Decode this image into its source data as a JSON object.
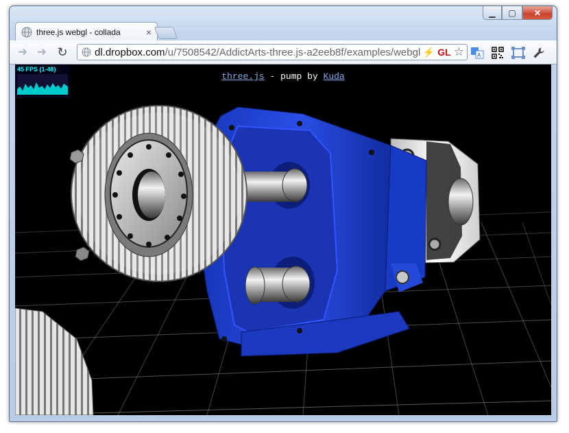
{
  "tab": {
    "title": "three.js webgl - collada",
    "close": "×"
  },
  "toolbar": {
    "url_host": "dl.dropbox.com",
    "url_path": "/u/7508542/AddictArts-three.js-a2eeb8f/examples/webgl",
    "gl_label": "GL"
  },
  "window_controls": {
    "minimize": "▁",
    "maximize": "▢",
    "close": "✕"
  },
  "page": {
    "stats_label": "45 FPS (1-48)",
    "caption_link1": "three.js",
    "caption_middle": " - pump by ",
    "caption_link2": "Kuda"
  },
  "colors": {
    "pump_body": "#1f3fd0",
    "gear": "#bfbfbf",
    "background": "#000000",
    "stats": "#00ffff",
    "link": "#87aee8"
  }
}
